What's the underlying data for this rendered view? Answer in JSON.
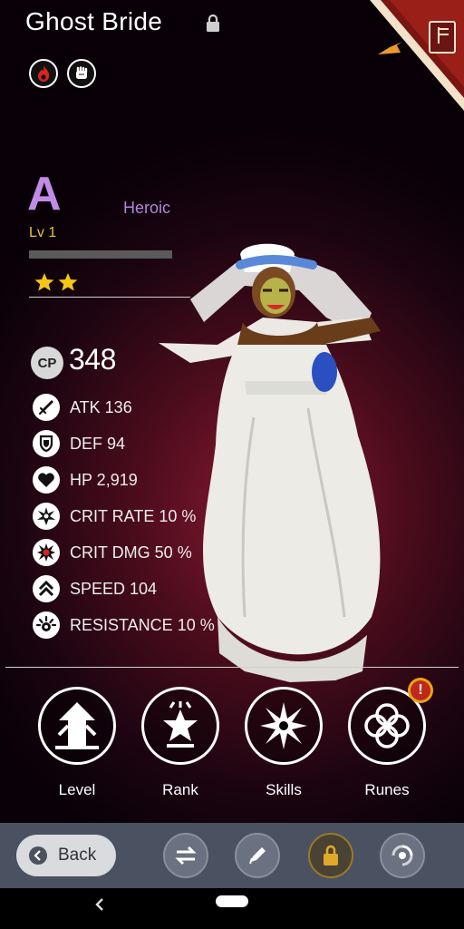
{
  "hero": {
    "name": "Ghost Bride",
    "grade": "A",
    "rarity": "Heroic",
    "level": "Lv 1",
    "stars": 2,
    "cp_label": "CP",
    "cp": "348"
  },
  "stats": [
    {
      "label": "ATK 136",
      "icon": "sword-icon"
    },
    {
      "label": "DEF 94",
      "icon": "shield-icon"
    },
    {
      "label": "HP 2,919",
      "icon": "heart-icon"
    },
    {
      "label": "CRIT RATE 10 %",
      "icon": "crit-rate-icon"
    },
    {
      "label": "CRIT DMG 50 %",
      "icon": "crit-dmg-icon"
    },
    {
      "label": "SPEED 104",
      "icon": "speed-icon"
    },
    {
      "label": "RESISTANCE 10 %",
      "icon": "resistance-icon"
    }
  ],
  "actions": [
    {
      "label": "Level",
      "icon": "level-up-icon"
    },
    {
      "label": "Rank",
      "icon": "rank-star-icon"
    },
    {
      "label": "Skills",
      "icon": "skills-burst-icon"
    },
    {
      "label": "Runes",
      "icon": "runes-knot-icon"
    }
  ],
  "alert_badge": "!",
  "toolbar": {
    "back_label": "Back"
  },
  "colors": {
    "grade": "#c08ce8",
    "rarity": "#b583e0",
    "level": "#e8c23a",
    "bar": "#4a5160",
    "badge": "#c0281a"
  },
  "xp_progress": 0
}
